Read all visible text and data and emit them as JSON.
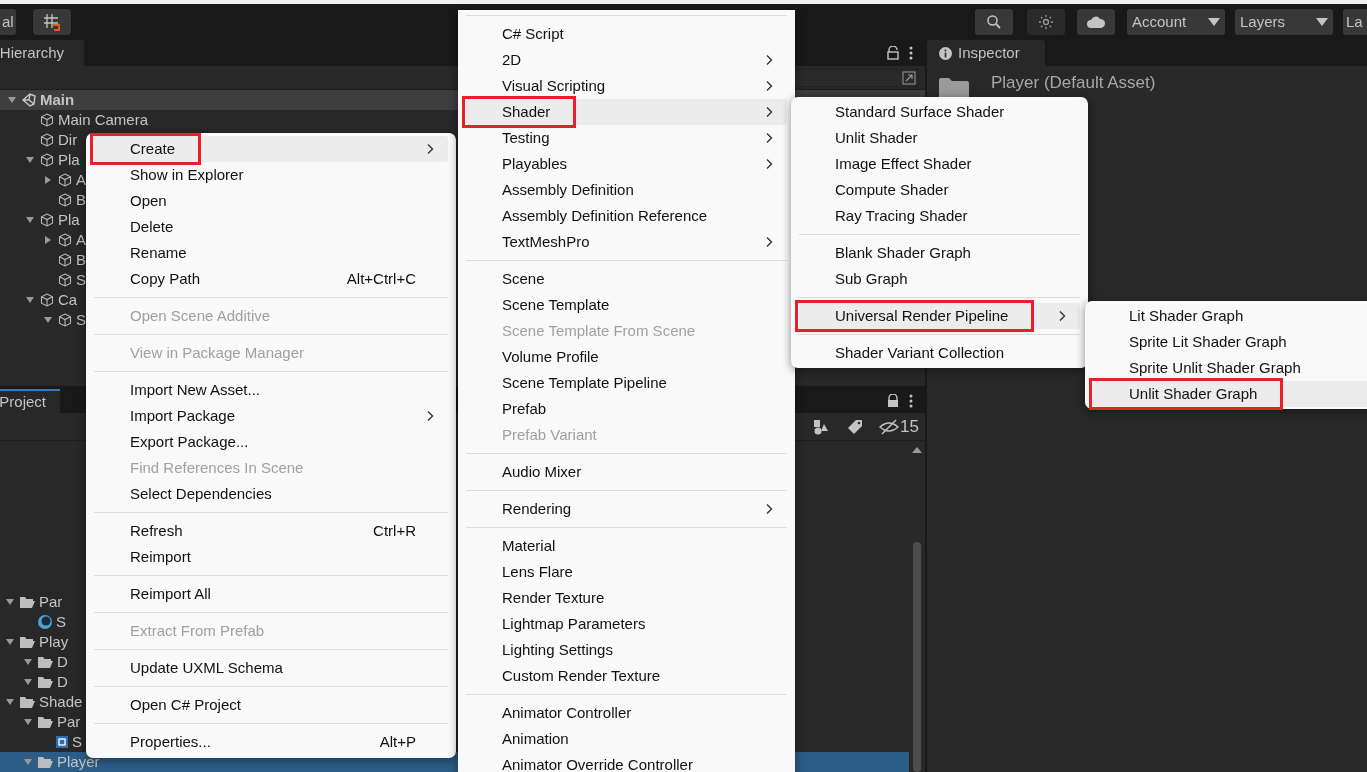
{
  "toolbar": {
    "left_button": "al",
    "account": "Account",
    "layers": "Layers",
    "layout": "La"
  },
  "hierarchy": {
    "tab": "Hierarchy",
    "items": [
      {
        "label": "Main",
        "kind": "scene",
        "expanded": true,
        "children": [
          {
            "label": "Main Camera",
            "kind": "object"
          },
          {
            "label": "Dir",
            "kind": "object"
          },
          {
            "label": "Pla",
            "kind": "object",
            "expanded": true,
            "children": [
              {
                "label": "A",
                "kind": "object",
                "expanded": false
              },
              {
                "label": "B",
                "kind": "object"
              }
            ]
          },
          {
            "label": "Pla",
            "kind": "object",
            "expanded": true,
            "children": [
              {
                "label": "A",
                "kind": "object",
                "expanded": false
              },
              {
                "label": "B",
                "kind": "object"
              },
              {
                "label": "S",
                "kind": "object"
              }
            ]
          },
          {
            "label": "Ca",
            "kind": "object",
            "expanded": true,
            "children": [
              {
                "label": "S",
                "kind": "object",
                "expanded": true
              }
            ]
          }
        ]
      }
    ]
  },
  "project": {
    "tab": "Project",
    "hidden_count": "15",
    "items": [
      {
        "label": "Par",
        "kind": "folder",
        "expanded": true,
        "selected": false,
        "children": [
          {
            "label": "S",
            "kind": "material",
            "selected": false
          }
        ]
      },
      {
        "label": "Play",
        "kind": "folder",
        "expanded": true,
        "selected": false,
        "children": [
          {
            "label": "D",
            "kind": "folder",
            "expanded": true,
            "selected": false
          },
          {
            "label": "D",
            "kind": "folder",
            "expanded": true,
            "selected": false
          }
        ]
      },
      {
        "label": "Shade",
        "kind": "folder",
        "expanded": true,
        "selected": false,
        "children": [
          {
            "label": "Par",
            "kind": "folder",
            "expanded": true,
            "selected": false,
            "children": [
              {
                "label": "S",
                "kind": "shader",
                "selected": false
              }
            ]
          },
          {
            "label": "Player",
            "kind": "folder",
            "expanded": true,
            "selected": true
          }
        ]
      }
    ]
  },
  "inspector": {
    "tab": "Inspector",
    "title": "Player (Default Asset)"
  },
  "menus": [
    {
      "items": [
        {
          "kind": "item",
          "label": "Create",
          "submenu": true,
          "disabled": false,
          "selected": true
        },
        {
          "kind": "item",
          "label": "Show in Explorer",
          "submenu": false,
          "disabled": false,
          "selected": false
        },
        {
          "kind": "item",
          "label": "Open",
          "submenu": false,
          "disabled": false,
          "selected": false
        },
        {
          "kind": "item",
          "label": "Delete",
          "submenu": false,
          "disabled": false,
          "selected": false
        },
        {
          "kind": "item",
          "label": "Rename",
          "submenu": false,
          "disabled": false,
          "selected": false
        },
        {
          "kind": "item",
          "label": "Copy Path",
          "shortcut": "Alt+Ctrl+C",
          "submenu": false,
          "disabled": false,
          "selected": false
        },
        {
          "kind": "separator"
        },
        {
          "kind": "item",
          "label": "Open Scene Additive",
          "submenu": false,
          "disabled": true,
          "selected": false
        },
        {
          "kind": "separator"
        },
        {
          "kind": "item",
          "label": "View in Package Manager",
          "submenu": false,
          "disabled": true,
          "selected": false
        },
        {
          "kind": "separator"
        },
        {
          "kind": "item",
          "label": "Import New Asset...",
          "submenu": false,
          "disabled": false,
          "selected": false
        },
        {
          "kind": "item",
          "label": "Import Package",
          "submenu": true,
          "disabled": false,
          "selected": false
        },
        {
          "kind": "item",
          "label": "Export Package...",
          "submenu": false,
          "disabled": false,
          "selected": false
        },
        {
          "kind": "item",
          "label": "Find References In Scene",
          "submenu": false,
          "disabled": true,
          "selected": false
        },
        {
          "kind": "item",
          "label": "Select Dependencies",
          "submenu": false,
          "disabled": false,
          "selected": false
        },
        {
          "kind": "separator"
        },
        {
          "kind": "item",
          "label": "Refresh",
          "shortcut": "Ctrl+R",
          "submenu": false,
          "disabled": false,
          "selected": false
        },
        {
          "kind": "item",
          "label": "Reimport",
          "submenu": false,
          "disabled": false,
          "selected": false
        },
        {
          "kind": "separator"
        },
        {
          "kind": "item",
          "label": "Reimport All",
          "submenu": false,
          "disabled": false,
          "selected": false
        },
        {
          "kind": "separator"
        },
        {
          "kind": "item",
          "label": "Extract From Prefab",
          "submenu": false,
          "disabled": true,
          "selected": false
        },
        {
          "kind": "separator"
        },
        {
          "kind": "item",
          "label": "Update UXML Schema",
          "submenu": false,
          "disabled": false,
          "selected": false
        },
        {
          "kind": "separator"
        },
        {
          "kind": "item",
          "label": "Open C# Project",
          "submenu": false,
          "disabled": false,
          "selected": false
        },
        {
          "kind": "separator"
        },
        {
          "kind": "item",
          "label": "Properties...",
          "shortcut": "Alt+P",
          "submenu": false,
          "disabled": false,
          "selected": false
        }
      ]
    },
    {
      "items": [
        {
          "kind": "separator"
        },
        {
          "kind": "item",
          "label": "C# Script",
          "submenu": false,
          "disabled": false,
          "selected": false
        },
        {
          "kind": "item",
          "label": "2D",
          "submenu": true,
          "disabled": false,
          "selected": false
        },
        {
          "kind": "item",
          "label": "Visual Scripting",
          "submenu": true,
          "disabled": false,
          "selected": false
        },
        {
          "kind": "item",
          "label": "Shader",
          "submenu": true,
          "disabled": false,
          "selected": true
        },
        {
          "kind": "item",
          "label": "Testing",
          "submenu": true,
          "disabled": false,
          "selected": false
        },
        {
          "kind": "item",
          "label": "Playables",
          "submenu": true,
          "disabled": false,
          "selected": false
        },
        {
          "kind": "item",
          "label": "Assembly Definition",
          "submenu": false,
          "disabled": false,
          "selected": false
        },
        {
          "kind": "item",
          "label": "Assembly Definition Reference",
          "submenu": false,
          "disabled": false,
          "selected": false
        },
        {
          "kind": "item",
          "label": "TextMeshPro",
          "submenu": true,
          "disabled": false,
          "selected": false
        },
        {
          "kind": "separator"
        },
        {
          "kind": "item",
          "label": "Scene",
          "submenu": false,
          "disabled": false,
          "selected": false
        },
        {
          "kind": "item",
          "label": "Scene Template",
          "submenu": false,
          "disabled": false,
          "selected": false
        },
        {
          "kind": "item",
          "label": "Scene Template From Scene",
          "submenu": false,
          "disabled": true,
          "selected": false
        },
        {
          "kind": "item",
          "label": "Volume Profile",
          "submenu": false,
          "disabled": false,
          "selected": false
        },
        {
          "kind": "item",
          "label": "Scene Template Pipeline",
          "submenu": false,
          "disabled": false,
          "selected": false
        },
        {
          "kind": "item",
          "label": "Prefab",
          "submenu": false,
          "disabled": false,
          "selected": false
        },
        {
          "kind": "item",
          "label": "Prefab Variant",
          "submenu": false,
          "disabled": true,
          "selected": false
        },
        {
          "kind": "separator"
        },
        {
          "kind": "item",
          "label": "Audio Mixer",
          "submenu": false,
          "disabled": false,
          "selected": false
        },
        {
          "kind": "separator"
        },
        {
          "kind": "item",
          "label": "Rendering",
          "submenu": true,
          "disabled": false,
          "selected": false
        },
        {
          "kind": "separator"
        },
        {
          "kind": "item",
          "label": "Material",
          "submenu": false,
          "disabled": false,
          "selected": false
        },
        {
          "kind": "item",
          "label": "Lens Flare",
          "submenu": false,
          "disabled": false,
          "selected": false
        },
        {
          "kind": "item",
          "label": "Render Texture",
          "submenu": false,
          "disabled": false,
          "selected": false
        },
        {
          "kind": "item",
          "label": "Lightmap Parameters",
          "submenu": false,
          "disabled": false,
          "selected": false
        },
        {
          "kind": "item",
          "label": "Lighting Settings",
          "submenu": false,
          "disabled": false,
          "selected": false
        },
        {
          "kind": "item",
          "label": "Custom Render Texture",
          "submenu": false,
          "disabled": false,
          "selected": false
        },
        {
          "kind": "separator"
        },
        {
          "kind": "item",
          "label": "Animator Controller",
          "submenu": false,
          "disabled": false,
          "selected": false
        },
        {
          "kind": "item",
          "label": "Animation",
          "submenu": false,
          "disabled": false,
          "selected": false
        },
        {
          "kind": "item",
          "label": "Animator Override Controller",
          "submenu": false,
          "disabled": false,
          "selected": false
        }
      ]
    },
    {
      "items": [
        {
          "kind": "item",
          "label": "Standard Surface Shader",
          "submenu": false,
          "disabled": false,
          "selected": false
        },
        {
          "kind": "item",
          "label": "Unlit Shader",
          "submenu": false,
          "disabled": false,
          "selected": false
        },
        {
          "kind": "item",
          "label": "Image Effect Shader",
          "submenu": false,
          "disabled": false,
          "selected": false
        },
        {
          "kind": "item",
          "label": "Compute Shader",
          "submenu": false,
          "disabled": false,
          "selected": false
        },
        {
          "kind": "item",
          "label": "Ray Tracing Shader",
          "submenu": false,
          "disabled": false,
          "selected": false
        },
        {
          "kind": "separator"
        },
        {
          "kind": "item",
          "label": "Blank Shader Graph",
          "submenu": false,
          "disabled": false,
          "selected": false
        },
        {
          "kind": "item",
          "label": "Sub Graph",
          "submenu": false,
          "disabled": false,
          "selected": false
        },
        {
          "kind": "separator"
        },
        {
          "kind": "item",
          "label": "Universal Render Pipeline",
          "submenu": true,
          "disabled": false,
          "selected": true
        },
        {
          "kind": "separator"
        },
        {
          "kind": "item",
          "label": "Shader Variant Collection",
          "submenu": false,
          "disabled": false,
          "selected": false
        }
      ]
    },
    {
      "items": [
        {
          "kind": "item",
          "label": "Lit Shader Graph",
          "submenu": false,
          "disabled": false,
          "selected": false
        },
        {
          "kind": "item",
          "label": "Sprite Lit Shader Graph",
          "submenu": false,
          "disabled": false,
          "selected": false
        },
        {
          "kind": "item",
          "label": "Sprite Unlit Shader Graph",
          "submenu": false,
          "disabled": false,
          "selected": false
        },
        {
          "kind": "item",
          "label": "Unlit Shader Graph",
          "submenu": false,
          "disabled": false,
          "selected": true
        }
      ]
    }
  ]
}
